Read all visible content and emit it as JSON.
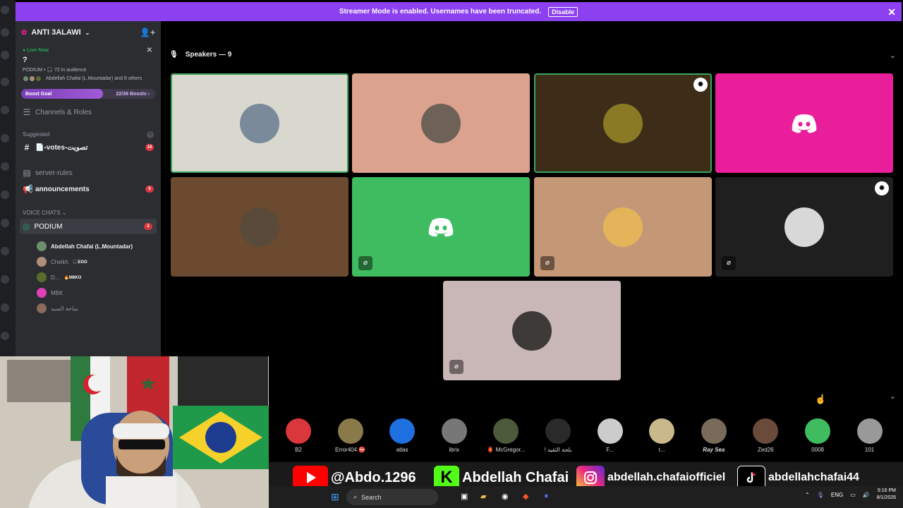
{
  "banner": {
    "text": "Streamer Mode is enabled. Usernames have been truncated.",
    "button": "Disable",
    "close": "✕"
  },
  "server": {
    "name": "ANTI 3ALAWI"
  },
  "stage": {
    "live_label": "Live Now",
    "title": "?",
    "meta": "PODIUM • 🎧 72 in audience",
    "people": "Abdellah Chafai (L.Mountadar) and 8 others"
  },
  "boost": {
    "label": "Boost Goal",
    "count": "22/36 Boosts ›",
    "progress": 0.61
  },
  "channels": {
    "roles": "Channels & Roles",
    "suggested": "Suggested",
    "votes": "📄-votes-تصويت",
    "votes_badge": "10",
    "server_rules": "server-rules",
    "announcements": "announcements",
    "announcements_badge": "6",
    "voice_section": "VOICE CHATS ⌄",
    "podium": "PODIUM",
    "podium_badge": "3"
  },
  "members": [
    {
      "name": "Abdellah Chafai (L.Mountadar)",
      "tag": "",
      "color": "#6d8f6e"
    },
    {
      "name": "Cheikh",
      "tag": "🎧EGO",
      "color": "#b08f7a"
    },
    {
      "name": "D...",
      "tag": "🔥M6KO",
      "color": "#5a6b2e"
    },
    {
      "name": "MBK",
      "tag": "",
      "color": "#e03fb5"
    },
    {
      "name": "بماحة السيد",
      "tag": "",
      "color": "#8a6a58"
    }
  ],
  "speakers": {
    "title": "Speakers — 9"
  },
  "tiles": [
    {
      "bg": "#d8d8cf",
      "av": "#7a8a9a",
      "mute": false,
      "mod": false,
      "discord": false,
      "border": "#3ba55c"
    },
    {
      "bg": "#dba28d",
      "av": "#6e6158",
      "mute": false,
      "mod": false,
      "discord": false,
      "border": ""
    },
    {
      "bg": "#3c2c18",
      "av": "#8a7a26",
      "mute": false,
      "mod": true,
      "discord": false,
      "border": "#3ba55c"
    },
    {
      "bg": "#e91e9a",
      "av": "",
      "mute": false,
      "mod": false,
      "discord": true,
      "border": ""
    },
    {
      "bg": "#6b4a30",
      "av": "#5a4a3a",
      "mute": false,
      "mod": false,
      "discord": false,
      "border": ""
    },
    {
      "bg": "#3ebc5f",
      "av": "",
      "mute": true,
      "mod": false,
      "discord": true,
      "border": ""
    },
    {
      "bg": "#c49876",
      "av": "#e3b45a",
      "mute": true,
      "mod": false,
      "discord": false,
      "border": ""
    },
    {
      "bg": "#1f1f1f",
      "av": "#d8d8d8",
      "mute": true,
      "mod": true,
      "discord": false,
      "border": ""
    },
    {
      "bg": "#c9b6b7",
      "av": "#3d3a38",
      "mute": true,
      "mod": false,
      "discord": false,
      "border": ""
    }
  ],
  "audience": [
    {
      "name": "B2",
      "color": "#da373c",
      "style": ""
    },
    {
      "name": "Error404 ⛔",
      "color": "#8a7a4a",
      "style": ""
    },
    {
      "name": "atlas",
      "color": "#1e6fe0",
      "style": ""
    },
    {
      "name": "ibrix",
      "color": "#777777",
      "style": ""
    },
    {
      "name": "🏮 McGregor...",
      "color": "#4a5a3a",
      "style": ""
    },
    {
      "name": "! بلحة الثقيه",
      "color": "#2a2a2a",
      "style": ""
    },
    {
      "name": "F...",
      "color": "#cccccc",
      "style": ""
    },
    {
      "name": "t...",
      "color": "#c9b88a",
      "style": ""
    },
    {
      "name": "Ray Sea",
      "color": "#7a6a5a",
      "style": "it"
    },
    {
      "name": "Zed26",
      "color": "#6a4a3a",
      "style": ""
    },
    {
      "name": "0008",
      "color": "#3ebc5f",
      "style": ""
    },
    {
      "name": "101",
      "color": "#999999",
      "style": ""
    }
  ],
  "overlay": {
    "youtube": "@Abdo.1296",
    "kick": "Abdellah Chafai",
    "instagram": "abdellah.chafaiofficiel",
    "tiktok": "abdellahchafai44"
  },
  "taskbar": {
    "search": "Search",
    "lang": "ENG",
    "time": "9:16 PM",
    "date": "8/1/2026"
  }
}
